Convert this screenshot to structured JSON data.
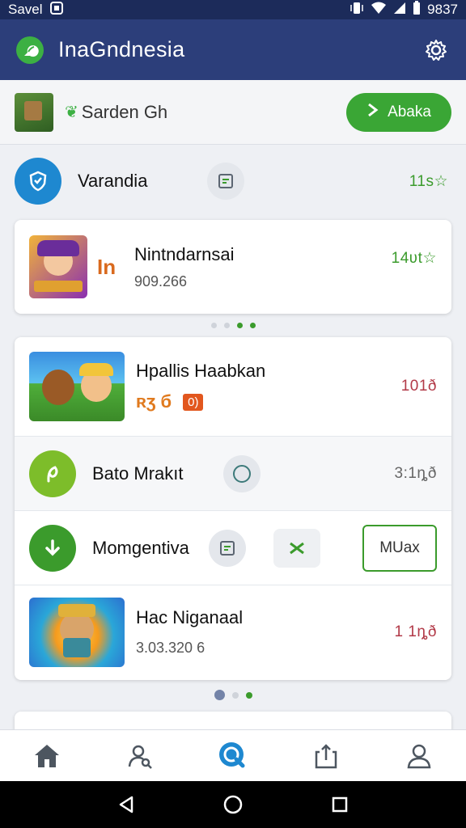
{
  "status_bar": {
    "left_text": "Savel",
    "time": "9837"
  },
  "app_bar": {
    "title": "InaGndnesia"
  },
  "banner": {
    "text": "Sarden Gh",
    "button_label": "Abaka"
  },
  "items": [
    {
      "title": "Varandia",
      "count": "11s☆"
    },
    {
      "title": "Nintndarnsai",
      "subtitle": "909.266",
      "count": "14ʋt☆",
      "badge": "In"
    },
    {
      "title": "Hpallis Haabkan",
      "count": "101ð",
      "badge_left": "ʀʒ б",
      "badge_right": "0)"
    },
    {
      "title": "Bato Mrakıt",
      "count": "3:1ȵð"
    },
    {
      "title": "Momgentiva",
      "button_label": "MUax"
    },
    {
      "title": "Hac Niganaal",
      "subtitle": "3.03.320 6",
      "count": "1 1ȵð"
    }
  ],
  "colors": {
    "primary": "#2c3e7a",
    "status_bar": "#1c2b5a",
    "accent_green": "#3b9b2c",
    "accent_blue": "#1e88d0",
    "count_red": "#b23a48"
  },
  "icons": {
    "status_left": "sim-icon",
    "status_right": [
      "vibrate-icon",
      "wifi-icon",
      "signal-icon",
      "battery-icon"
    ],
    "app_logo": "leaf-chat-icon",
    "settings": "gear-icon",
    "nav": [
      "home-icon",
      "profile-search-icon",
      "search-icon",
      "share-icon",
      "account-icon"
    ],
    "system_nav": [
      "back-icon",
      "home-circle-icon",
      "recents-icon"
    ]
  }
}
